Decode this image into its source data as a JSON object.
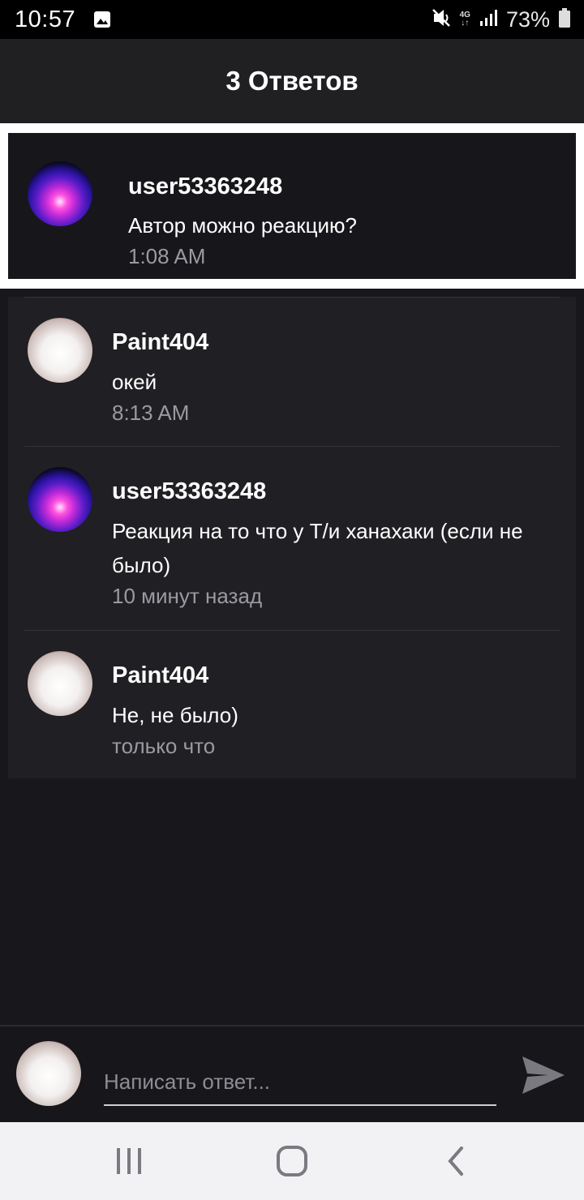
{
  "status_bar": {
    "time": "10:57",
    "network": "4G",
    "battery": "73%"
  },
  "header": {
    "title": "3 Ответов"
  },
  "parent_comment": {
    "author": "user53363248",
    "text": "Автор можно реакцию?",
    "time": "1:08 AM",
    "avatar": "fire-avatar"
  },
  "replies": [
    {
      "author": "Paint404",
      "text": "окей",
      "time": "8:13 AM",
      "avatar": "cat-avatar"
    },
    {
      "author": "user53363248",
      "text": "Реакция на то что у Т/и ханахаки (если не было)",
      "time": "10 минут назад",
      "avatar": "fire-avatar"
    },
    {
      "author": "Paint404",
      "text": "Не, не было)",
      "time": "только что",
      "avatar": "cat-avatar"
    }
  ],
  "reply_input": {
    "placeholder": "Написать ответ..."
  },
  "icons": {
    "gallery": "gallery-icon",
    "mute": "mute-icon",
    "signal": "signal-icon",
    "battery": "battery-icon",
    "send": "send-icon",
    "recents": "recents-icon",
    "home": "home-icon",
    "back": "back-icon"
  },
  "colors": {
    "background": "#18171b",
    "header": "#202023",
    "reply_panel": "#201f23",
    "muted_text": "#9b9aa0"
  }
}
